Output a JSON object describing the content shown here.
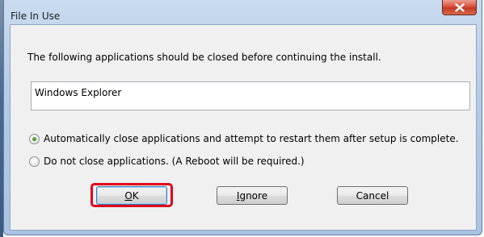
{
  "window": {
    "title": "File In Use",
    "close_icon": "close-x-icon"
  },
  "dialog": {
    "message": "The following applications should be closed before continuing the install.",
    "applications": [
      "Windows Explorer"
    ],
    "options": [
      {
        "label": "Automatically close applications and attempt to restart them after setup is complete.",
        "selected": true
      },
      {
        "label": "Do not close applications. (A Reboot will be required.)",
        "selected": false
      }
    ]
  },
  "buttons": {
    "ok": {
      "accel": "O",
      "rest": "K"
    },
    "ignore": {
      "accel": "I",
      "rest": "gnore"
    },
    "cancel": "Cancel"
  },
  "colors": {
    "highlight": "#e0001a",
    "close_button": "#c33a22",
    "radio_dot": "#2e7d1c"
  }
}
